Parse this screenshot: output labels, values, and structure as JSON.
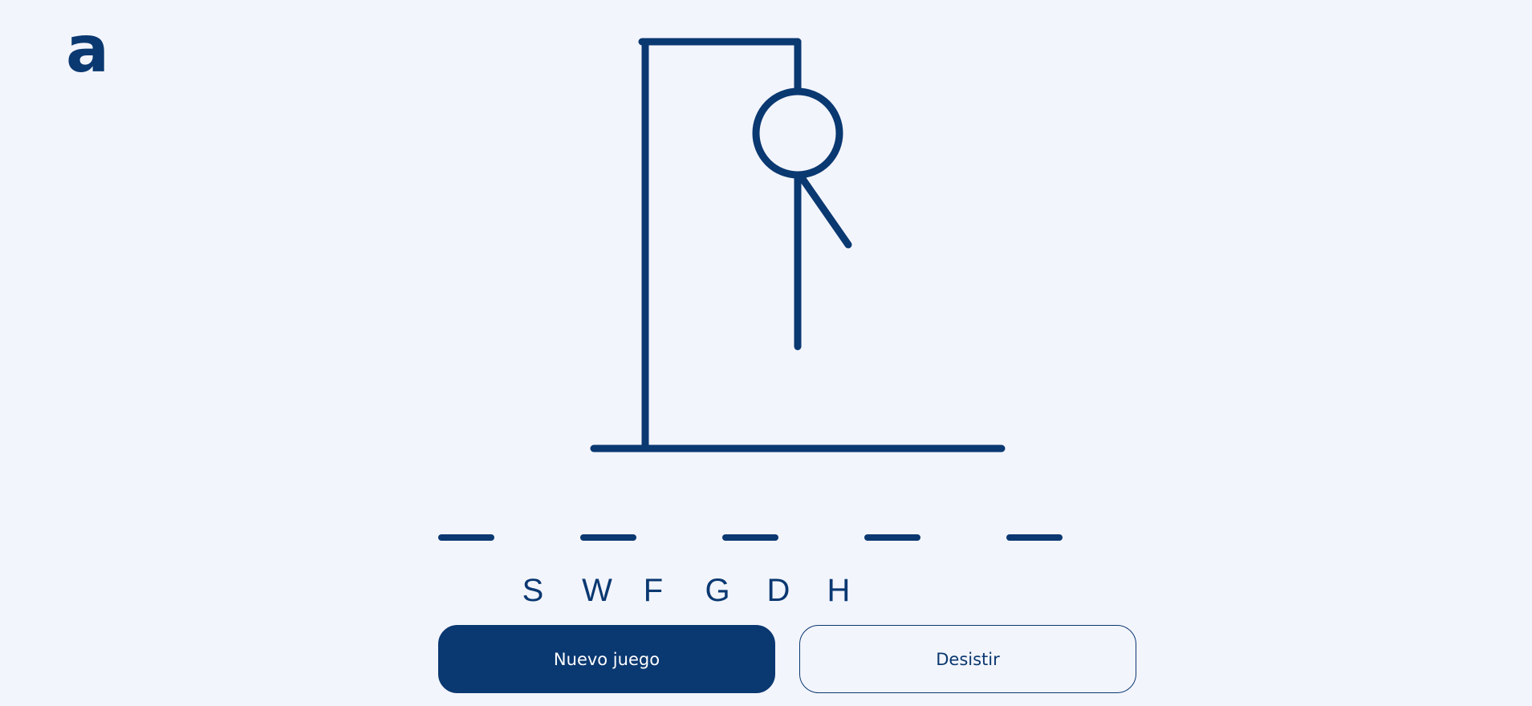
{
  "logo": {
    "text": "a",
    "color": "#0a3871"
  },
  "game": {
    "word_length": 5,
    "wrong_letters": [
      "S",
      "W",
      "F",
      "G",
      "D",
      "H"
    ],
    "hangman_parts_drawn": [
      "base",
      "pole",
      "beam",
      "rope",
      "head",
      "body",
      "right-arm"
    ]
  },
  "buttons": {
    "new_game": "Nuevo juego",
    "give_up": "Desistir"
  },
  "colors": {
    "background": "#f3f5fc",
    "primary": "#0a3871"
  }
}
